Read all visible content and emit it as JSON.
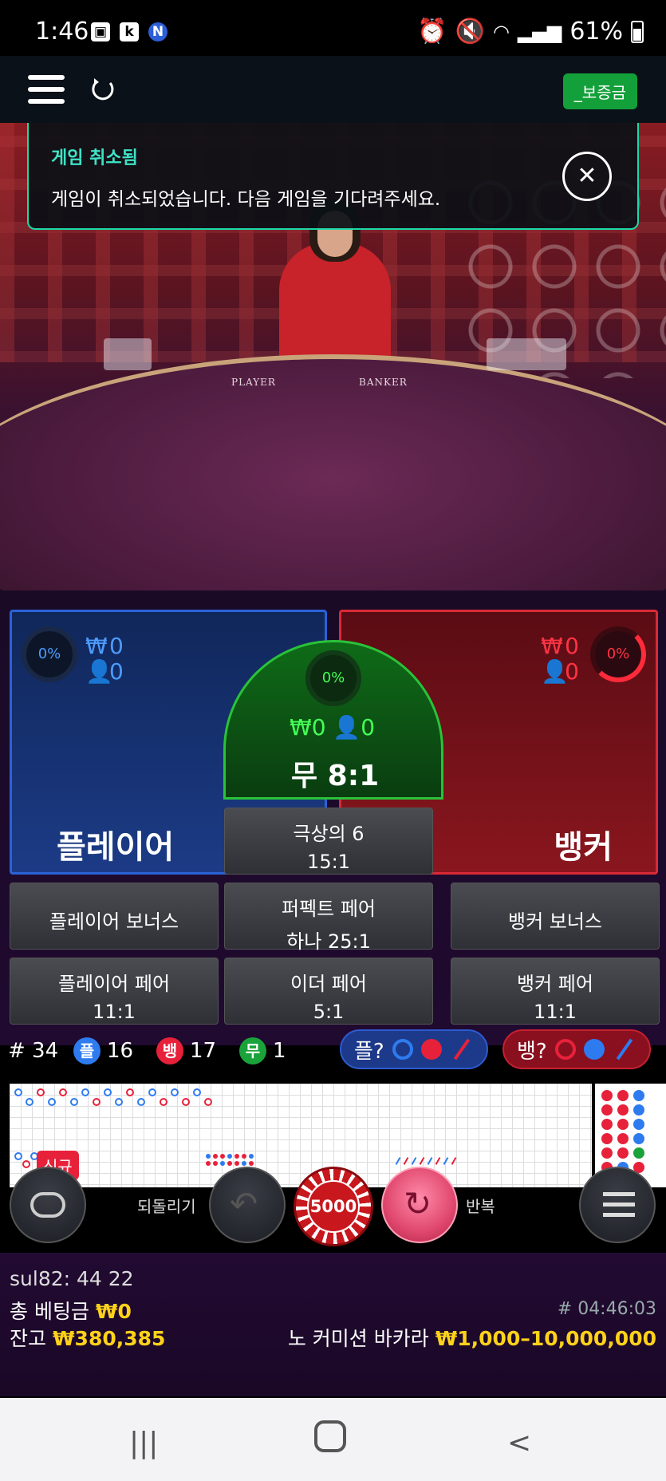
{
  "status_bar": {
    "time": "1:46",
    "battery": "61%",
    "icons": [
      "gallery-icon",
      "k-icon",
      "n-icon",
      "alarm-icon",
      "mute-icon",
      "wifi-icon",
      "signal-icon",
      "battery-icon"
    ]
  },
  "app_bar": {
    "menu_icon": "hamburger-icon",
    "reload_icon": "reload-icon",
    "deposit_label": "_보증금"
  },
  "toast": {
    "title": "게임 취소됨",
    "message": "게임이 취소되었습니다. 다음 게임을 기다려주세요.",
    "close_icon": "close-icon"
  },
  "video": {
    "player_label": "PLAYER",
    "banker_label": "BANKER"
  },
  "bets": {
    "player": {
      "percent": "0%",
      "amount": "0",
      "count": "0",
      "label": "플레이어",
      "currency": "₩"
    },
    "banker": {
      "percent": "0%",
      "amount": "0",
      "count": "0",
      "label": "뱅커",
      "currency": "₩"
    },
    "tie": {
      "percent": "0%",
      "amount": "0",
      "count": "0",
      "label": "무 8:1",
      "currency": "₩"
    },
    "super6": {
      "line1": "극상의 6",
      "line2": "15:1"
    },
    "player_bonus": {
      "label": "플레이어 보너스"
    },
    "perfect_pair": {
      "line1": "퍼펙트 페어",
      "line2": "하나 25:1"
    },
    "banker_bonus": {
      "label": "뱅커 보너스"
    },
    "player_pair": {
      "line1": "플레이어 페어",
      "line2": "11:1"
    },
    "either_pair": {
      "line1": "이더 페어",
      "line2": "5:1"
    },
    "banker_pair": {
      "line1": "뱅커 페어",
      "line2": "11:1"
    }
  },
  "stats": {
    "round": "# 34",
    "player_symbol": "플",
    "player_count": "16",
    "banker_symbol": "뱅",
    "banker_count": "17",
    "tie_symbol": "무",
    "tie_count": "1",
    "player_predict": "플?",
    "banker_predict": "뱅?",
    "colors": {
      "player": "#2e7bf0",
      "banker": "#e8213a",
      "tie": "#19a33a"
    }
  },
  "roadmap": {
    "new_badge": "신규"
  },
  "controls": {
    "undo_label": "되돌리기",
    "repeat_label": "반복",
    "chip_value": "5000"
  },
  "footer": {
    "user": "sul82: 44 22",
    "total_bet_label": "총 베팅금",
    "total_bet_value": "₩0",
    "balance_label": "잔고",
    "balance_value": "₩380,385",
    "game_id": "# 04:46:03",
    "table_name": "노 커미션 바카라",
    "limits": "₩1,000–10,000,000"
  }
}
